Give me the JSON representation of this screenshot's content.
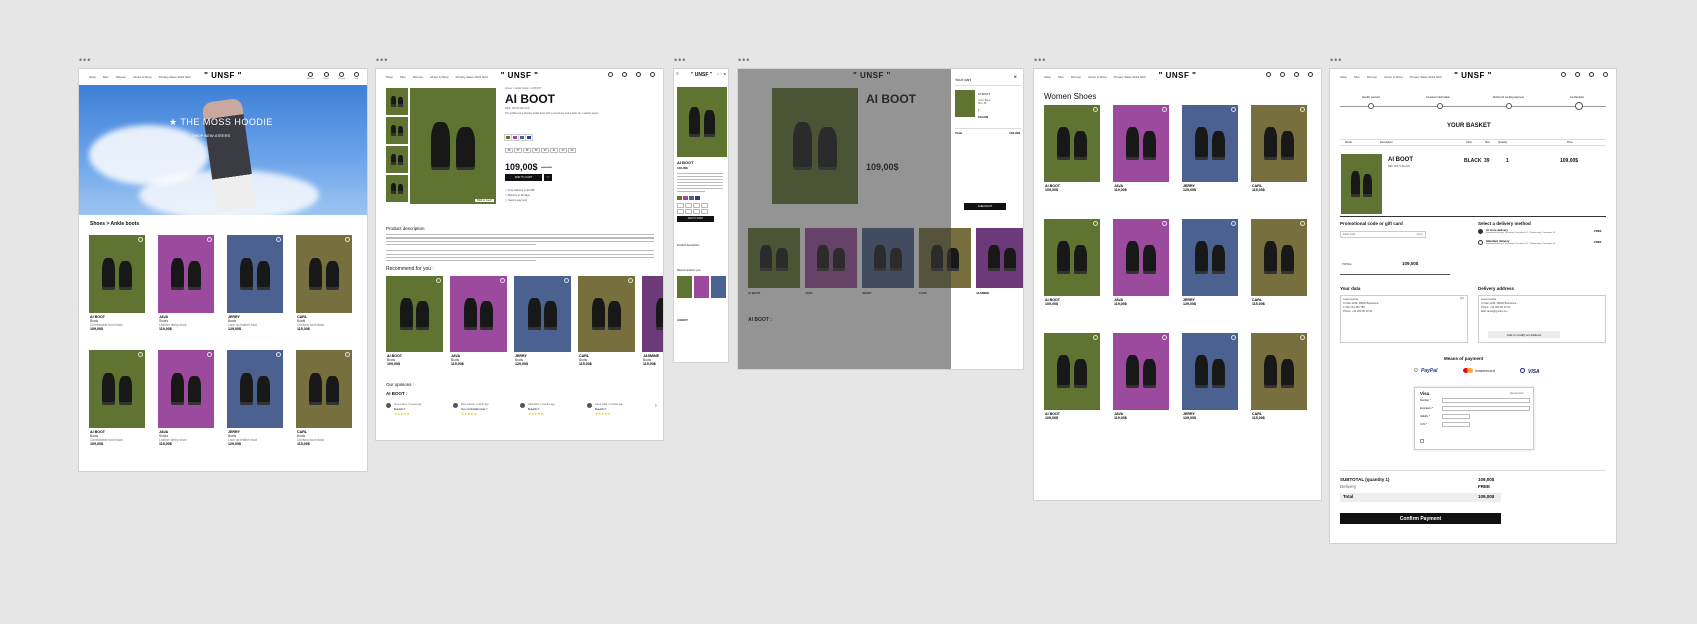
{
  "header": {
    "logo": "\" UNSF \"",
    "nav": [
      "Shop",
      "Men",
      "Women",
      "About & Shop",
      "Privacy dates 2021 field"
    ],
    "icons": [
      {
        "name": "user-icon",
        "label": "Account"
      },
      {
        "name": "pin-icon",
        "label": "Stores"
      },
      {
        "name": "heart-icon",
        "label": "Wishlist"
      },
      {
        "name": "bag-icon",
        "label": "Bag"
      }
    ]
  },
  "home": {
    "hero_title": "★ THE MOSS HOODIE",
    "hero_sub": "SHOP NEW ATEERS",
    "section_title": "Shoes > Ankle boots",
    "products": [
      {
        "name": "AI BOOT",
        "cat": "Boots",
        "desc": "Comfortable boot black",
        "price": "109,00$",
        "color": "#5e7430"
      },
      {
        "name": "JAVA",
        "cat": "Shoes",
        "desc": "Leather derby shoe",
        "price": "119,00$",
        "color": "#9b4a9d"
      },
      {
        "name": "JERRY",
        "cat": "Boots",
        "desc": "Lace up leather boot",
        "price": "129,00$",
        "color": "#4b618f"
      },
      {
        "name": "CARL",
        "cat": "Boots",
        "desc": "Chelsea boot black",
        "price": "115,00$",
        "color": "#77703e"
      },
      {
        "name": "AI BOOT",
        "cat": "Boots",
        "desc": "Comfortable boot black",
        "price": "109,00$",
        "color": "#5e7430"
      },
      {
        "name": "JAVA",
        "cat": "Shoes",
        "desc": "Leather derby shoe",
        "price": "119,00$",
        "color": "#9b4a9d"
      },
      {
        "name": "JERRY",
        "cat": "Boots",
        "desc": "Lace up leather boot",
        "price": "129,00$",
        "color": "#4b618f"
      },
      {
        "name": "CARL",
        "cat": "Boots",
        "desc": "Chelsea boot black",
        "price": "115,00$",
        "color": "#77703e"
      }
    ]
  },
  "pdp": {
    "breadcrumb": "Home > Ankle boots > AI BOOT",
    "title": "AI BOOT",
    "ref": "REF. 00471-BLACK",
    "desc_short": "The AI Boot is a chunky ankle boot with a round toe and a side zip. Leather upper.",
    "price": "109,00$",
    "old_price": "129,00$",
    "add_button": "ADD TO CART",
    "sizes": [
      "36",
      "37",
      "38",
      "39",
      "40",
      "41",
      "42",
      "43"
    ],
    "swatches": [
      "#5e7430",
      "#9b4a9d",
      "#4b618f",
      "#2a3c8c"
    ],
    "info": [
      "Free delivery in 24-48h",
      "Returns in 30 days",
      "Secure payment"
    ],
    "zoom_label": "Click to zoom",
    "section_desc": "Product description",
    "desc_long": "The AI Boot is a chunky ankle boot with a round toe and a side zip, designed for everyday wear.",
    "recommended": "Recommend for you :",
    "opinions": "Our opinions :",
    "opinions_product": "AI BOOT :",
    "reviews": [
      {
        "name": "Anna Lopez, 3 weeks ago",
        "text": "Beautiful !!"
      },
      {
        "name": "Marc Garcia, 1 month ago",
        "text": "Very comfortable boots !!"
      },
      {
        "name": "Julia Marti, 2 months ago",
        "text": "Beautiful !!"
      },
      {
        "name": "Laura Vidal, 2 months ago",
        "text": "Beautiful !!"
      }
    ],
    "rec": [
      {
        "name": "AI BOOT",
        "price": "109,00$"
      },
      {
        "name": "JAVA",
        "price": "119,00$"
      },
      {
        "name": "JERRY",
        "price": "129,00$"
      },
      {
        "name": "CARL",
        "price": "115,00$"
      },
      {
        "name": "JASMINE",
        "price": "119,00$"
      }
    ],
    "stars": "★★★★★"
  },
  "mobile": {
    "title": "AI BOOT",
    "price": "109,00$",
    "add": "ADD TO CART",
    "desc": "Product description",
    "rec": "Recommend for you",
    "opinions": "AI BOOT"
  },
  "cart": {
    "title": "Your cart",
    "close": "×",
    "item": "AI BOOT",
    "item_desc": "Color: Black Size: 39",
    "item_qty": "1",
    "item_price": "109,00$",
    "total_label": "Total",
    "total": "109,00$",
    "checkout": "CHECKOUT"
  },
  "listing": {
    "title": "Women Shoes",
    "products": [
      {
        "name": "AI BOOT",
        "price": "109,00$",
        "color": "#5e7430"
      },
      {
        "name": "JAVA",
        "price": "119,00$",
        "color": "#9b4a9d"
      },
      {
        "name": "JERRY",
        "price": "129,00$",
        "color": "#4b618f"
      },
      {
        "name": "CARL",
        "price": "115,00$",
        "color": "#77703e"
      },
      {
        "name": "AI BOOT",
        "price": "109,00$",
        "color": "#5e7430"
      },
      {
        "name": "JAVA",
        "price": "119,00$",
        "color": "#9b4a9d"
      },
      {
        "name": "JERRY",
        "price": "129,00$",
        "color": "#4b618f"
      },
      {
        "name": "CARL",
        "price": "115,00$",
        "color": "#77703e"
      },
      {
        "name": "AI BOOT",
        "price": "109,00$",
        "color": "#5e7430"
      },
      {
        "name": "JAVA",
        "price": "119,00$",
        "color": "#9b4a9d"
      },
      {
        "name": "JERRY",
        "price": "129,00$",
        "color": "#4b618f"
      },
      {
        "name": "CARL",
        "price": "115,00$",
        "color": "#77703e"
      }
    ]
  },
  "checkout": {
    "steps": [
      "Identify yourself",
      "Customer information",
      "Method of sending payment",
      "Confirmation"
    ],
    "title": "YOUR BASKET",
    "columns": [
      "Article",
      "Description",
      "Color",
      "Size",
      "Quantity",
      "Price"
    ],
    "item_name": "AI BOOT",
    "item_ref": "REF. 00471-BLACK",
    "item_color": "BLACK",
    "item_size": "39",
    "item_qty": "1",
    "item_price": "109,00$",
    "promo_title": "Promotional code or gift card",
    "promo_placeholder": "Enter code",
    "promo_apply": "Apply",
    "total_label": "TOTAL:",
    "total": "109,00$",
    "delivery_title": "Select a delivery method",
    "delivery_options": [
      {
        "label": "At store delivery",
        "desc": "Estimated delivery Thursday, December 18 - Wednesday, December 24",
        "price": "FREE"
      },
      {
        "label": "Standard delivery",
        "desc": "Estimated delivery Thursday, December 18 - Wednesday, December 24",
        "price": "FREE"
      }
    ],
    "your_data": "Your data",
    "edit": "Edit",
    "your_data_lines": [
      "Laura Garcia",
      "C/ Mar 1234, 08020 Barcelona",
      "T 000 123 456 789",
      "Phone: +34 000 00 00 00"
    ],
    "address_title": "Delivery address",
    "address_lines": [
      "Laura Garcia",
      "C/ Mar 1234, 08020 Barcelona",
      "Phone: +34 000 00 00 00",
      "Mail: laura@gmail.com"
    ],
    "add_address": "Add or modify an address",
    "payment_title": "Means of payment",
    "payments": [
      "PayPal",
      "mastercard",
      "VISA"
    ],
    "visa_title": "Visa",
    "visa_fields": [
      "Number *",
      "Expiration *",
      "Validity *",
      "CVC *"
    ],
    "visa_hint": "Secure form",
    "subtotal_label": "SUBTOTAL (quantity 1)",
    "subtotal": "109,00$",
    "delivery_label": "Delivery",
    "delivery_val": "FREE",
    "grand_label": "Total",
    "grand": "109,00$",
    "confirm": "Confirm Payment"
  }
}
